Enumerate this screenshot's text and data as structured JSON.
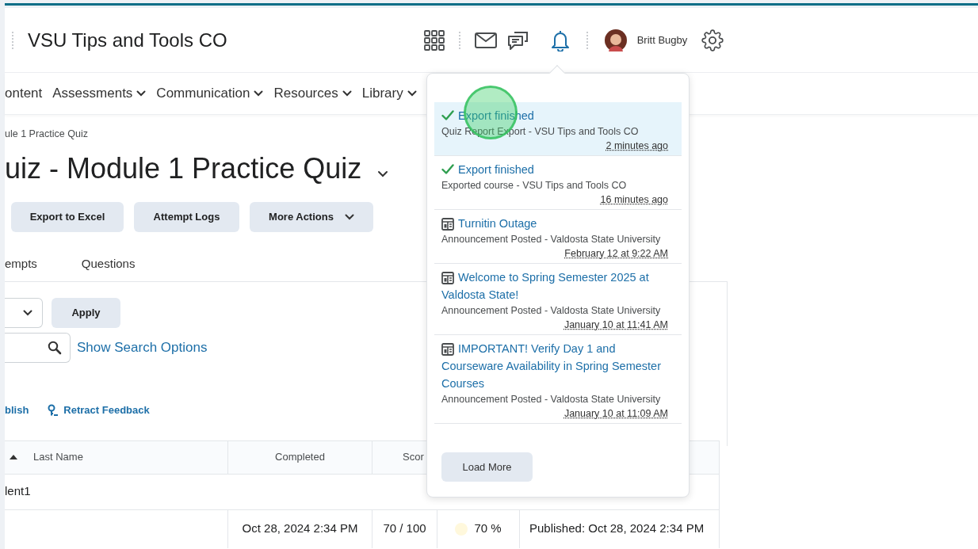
{
  "header": {
    "course_title": "VSU Tips and Tools CO",
    "user_name": "Britt Bugby"
  },
  "nav": {
    "items": [
      {
        "label": "ontent",
        "has_menu": false
      },
      {
        "label": "Assessments",
        "has_menu": true
      },
      {
        "label": "Communication",
        "has_menu": true
      },
      {
        "label": "Resources",
        "has_menu": true
      },
      {
        "label": "Library",
        "has_menu": true
      }
    ]
  },
  "breadcrumb": "ule 1 Practice Quiz",
  "page_title": "uiz - Module 1 Practice Quiz",
  "actions": [
    {
      "label": "Export to Excel",
      "has_menu": false
    },
    {
      "label": "Attempt Logs",
      "has_menu": false
    },
    {
      "label": "More Actions",
      "has_menu": true
    }
  ],
  "tabs": [
    {
      "label": "empts"
    },
    {
      "label": "Questions"
    }
  ],
  "filter": {
    "apply_label": "Apply"
  },
  "search": {
    "options_link": "Show Search Options"
  },
  "bulk_actions": [
    {
      "label": "blish",
      "kind": "text"
    },
    {
      "label": "Retract Feedback",
      "kind": "retract"
    }
  ],
  "table": {
    "columns": [
      "Last Name",
      "Completed",
      "Scor"
    ],
    "group_row": "lent1",
    "rows": [
      {
        "completed": "Oct 28, 2024 2:34 PM",
        "score": "70 / 100",
        "percent": "70 %",
        "color": "#fff8dc",
        "status": "Published: Oct 28, 2024 2:34 PM"
      }
    ]
  },
  "notifications": {
    "items": [
      {
        "kind": "export",
        "highlighted": true,
        "title": "Export finished",
        "detail": "Quiz Report Export - VSU Tips and Tools CO",
        "time": "2 minutes ago"
      },
      {
        "kind": "export",
        "highlighted": false,
        "title": "Export finished",
        "detail": "Exported course - VSU Tips and Tools CO",
        "time": "16 minutes ago"
      },
      {
        "kind": "announcement",
        "highlighted": false,
        "title": "Turnitin Outage",
        "detail": "Announcement Posted - Valdosta State University",
        "time": "February 12 at 9:22 AM"
      },
      {
        "kind": "announcement",
        "highlighted": false,
        "title": "Welcome to Spring Semester 2025 at Valdosta State!",
        "detail": "Announcement Posted - Valdosta State University",
        "time": "January 10 at 11:41 AM"
      },
      {
        "kind": "announcement",
        "highlighted": false,
        "title": "IMPORTANT! Verify Day 1 and Courseware Availability in Spring Semester Courses",
        "detail": "Announcement Posted - Valdosta State University",
        "time": "January 10 at 11:09 AM"
      }
    ],
    "load_more": "Load More"
  }
}
